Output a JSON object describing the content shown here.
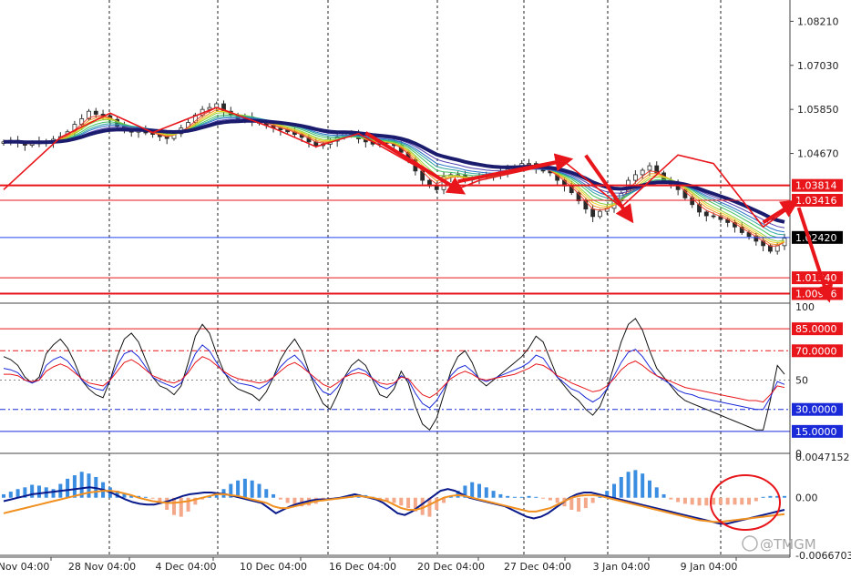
{
  "chart_data": [
    {
      "type": "candlestick",
      "role": "price",
      "ylim": [
        1.0066,
        1.0878
      ],
      "y_ticks": [
        "1.08210",
        "1.07030",
        "1.05850",
        "1.04670"
      ],
      "levels": [
        {
          "value": 1.03814,
          "label": "1.03814",
          "color": "#e8161b",
          "thick": true
        },
        {
          "value": 1.03416,
          "label": "1.03416",
          "color": "#e8161b",
          "thick": false
        },
        {
          "value": 1.0242,
          "label": "1.02420",
          "color": "#000000",
          "line_color": "#2244ee",
          "thick": false
        },
        {
          "value": 1.0134,
          "label": "1.01340",
          "color": "#e8161b",
          "thick": false
        },
        {
          "value": 1.00916,
          "label": "1.00916",
          "color": "#e8161b",
          "thick": true
        }
      ],
      "close": [
        1.0498,
        1.0502,
        1.0495,
        1.0489,
        1.0493,
        1.05,
        1.0497,
        1.0505,
        1.0512,
        1.0525,
        1.0545,
        1.056,
        1.058,
        1.0572,
        1.0568,
        1.0558,
        1.054,
        1.053,
        1.0524,
        1.053,
        1.0522,
        1.0518,
        1.0512,
        1.0507,
        1.052,
        1.0535,
        1.055,
        1.057,
        1.0585,
        1.059,
        1.06,
        1.058,
        1.057,
        1.056,
        1.0565,
        1.0555,
        1.0548,
        1.0542,
        1.0535,
        1.053,
        1.0525,
        1.0518,
        1.051,
        1.0498,
        1.0488,
        1.0492,
        1.05,
        1.051,
        1.052,
        1.0518,
        1.0506,
        1.0498,
        1.0492,
        1.0495,
        1.0497,
        1.0488,
        1.047,
        1.045,
        1.042,
        1.0395,
        1.038,
        1.037,
        1.0405,
        1.041,
        1.0408,
        1.0396,
        1.04,
        1.0406,
        1.0403,
        1.041,
        1.0418,
        1.0425,
        1.0432,
        1.044,
        1.044,
        1.0428,
        1.042,
        1.0415,
        1.0395,
        1.038,
        1.0362,
        1.034,
        1.0318,
        1.0298,
        1.0312,
        1.032,
        1.034,
        1.036,
        1.0395,
        1.041,
        1.0422,
        1.0434,
        1.0415,
        1.0395,
        1.0385,
        1.037,
        1.0348,
        1.033,
        1.031,
        1.03,
        1.0298,
        1.029,
        1.0282,
        1.027,
        1.0255,
        1.0245,
        1.0232,
        1.022,
        1.0205,
        1.022,
        1.024
      ],
      "ema_band_colors": [
        "#e84030",
        "#f09020",
        "#e8d020",
        "#90d040",
        "#40c060",
        "#30a8a0",
        "#2a70c8",
        "#5040b0"
      ],
      "slow_ma_color": "#1c1c6e",
      "zigzag": [
        [
          0,
          1.037
        ],
        [
          8,
          1.051
        ],
        [
          15,
          1.0575
        ],
        [
          21,
          1.0523
        ],
        [
          30,
          1.059
        ],
        [
          38,
          1.0535
        ],
        [
          44,
          1.0485
        ],
        [
          50,
          1.052
        ],
        [
          57,
          1.0445
        ],
        [
          64,
          1.0372
        ],
        [
          67,
          1.0395
        ],
        [
          79,
          1.0445
        ],
        [
          87,
          1.0323
        ],
        [
          95,
          1.0463
        ],
        [
          100,
          1.044
        ],
        [
          107,
          1.027
        ],
        [
          111,
          1.0325
        ]
      ],
      "arrows": [
        [
          51,
          1.0522,
          64,
          1.037
        ],
        [
          64,
          1.0392,
          79,
          1.0448
        ],
        [
          82,
          1.0462,
          88,
          1.03
        ],
        [
          97,
          1.0455
        ],
        [
          107,
          1.0282,
          111,
          1.033
        ],
        [
          112,
          1.0322,
          116,
          1.009
        ]
      ]
    },
    {
      "type": "line",
      "role": "oscillator",
      "ylim": [
        0,
        100
      ],
      "y_ticks": [
        "100",
        "50",
        "0"
      ],
      "levels": [
        {
          "value": 85,
          "label": "85.0000",
          "color": "#e8161b",
          "style": "solid"
        },
        {
          "value": 70,
          "label": "70.0000",
          "color": "#e8161b",
          "style": "dashdot"
        },
        {
          "value": 30,
          "label": "30.0000",
          "color": "#1a2ad8",
          "style": "dashdot"
        },
        {
          "value": 15,
          "label": "15.0000",
          "color": "#1a2ad8",
          "style": "solid"
        }
      ],
      "series": [
        {
          "color": "#111111",
          "values": [
            66,
            64,
            60,
            52,
            48,
            52,
            68,
            74,
            78,
            72,
            62,
            50,
            44,
            40,
            38,
            50,
            66,
            78,
            82,
            76,
            64,
            52,
            46,
            44,
            40,
            46,
            62,
            80,
            88,
            82,
            68,
            56,
            48,
            44,
            42,
            40,
            36,
            42,
            52,
            64,
            72,
            78,
            70,
            56,
            44,
            34,
            30,
            40,
            52,
            60,
            64,
            60,
            50,
            40,
            38,
            44,
            56,
            48,
            32,
            20,
            16,
            24,
            40,
            56,
            66,
            70,
            62,
            50,
            46,
            50,
            54,
            58,
            62,
            66,
            72,
            80,
            76,
            64,
            52,
            46,
            40,
            36,
            30,
            26,
            32,
            44,
            60,
            76,
            88,
            92,
            84,
            70,
            58,
            52,
            46,
            40,
            36,
            34,
            32,
            30,
            28,
            26,
            24,
            22,
            20,
            18,
            16,
            16,
            36,
            60,
            54
          ]
        },
        {
          "color": "#1a28d8",
          "values": [
            58,
            57,
            55,
            50,
            48,
            50,
            60,
            64,
            66,
            63,
            57,
            50,
            46,
            44,
            43,
            50,
            60,
            68,
            70,
            66,
            59,
            52,
            49,
            47,
            45,
            48,
            57,
            68,
            74,
            70,
            62,
            55,
            51,
            48,
            47,
            46,
            44,
            47,
            52,
            59,
            64,
            67,
            62,
            55,
            48,
            42,
            40,
            45,
            52,
            56,
            58,
            56,
            51,
            46,
            44,
            47,
            53,
            50,
            41,
            34,
            31,
            36,
            44,
            53,
            58,
            60,
            56,
            51,
            49,
            51,
            53,
            55,
            57,
            59,
            62,
            67,
            65,
            58,
            52,
            48,
            44,
            42,
            38,
            35,
            38,
            44,
            53,
            62,
            69,
            71,
            66,
            59,
            53,
            50,
            47,
            43,
            41,
            40,
            38,
            37,
            36,
            35,
            34,
            33,
            32,
            31,
            30,
            30,
            38,
            49,
            47
          ]
        },
        {
          "color": "#e8161b",
          "values": [
            54,
            54,
            53,
            50,
            49,
            50,
            56,
            59,
            61,
            59,
            55,
            51,
            48,
            47,
            46,
            50,
            56,
            62,
            64,
            61,
            57,
            53,
            51,
            49,
            48,
            50,
            55,
            62,
            66,
            64,
            60,
            56,
            53,
            51,
            50,
            49,
            48,
            49,
            52,
            56,
            60,
            62,
            59,
            55,
            51,
            47,
            45,
            48,
            52,
            54,
            55,
            54,
            51,
            48,
            47,
            48,
            52,
            51,
            45,
            40,
            38,
            41,
            46,
            51,
            54,
            56,
            54,
            51,
            50,
            51,
            52,
            53,
            54,
            56,
            58,
            61,
            60,
            57,
            53,
            51,
            48,
            46,
            44,
            42,
            43,
            46,
            51,
            57,
            61,
            63,
            60,
            56,
            53,
            51,
            49,
            47,
            45,
            44,
            43,
            42,
            41,
            40,
            39,
            38,
            37,
            36,
            36,
            35,
            40,
            46,
            45
          ]
        }
      ]
    },
    {
      "type": "bar",
      "role": "histogram",
      "ylim": [
        -0.0066703,
        0.0047152
      ],
      "y_ticks": [
        "0.0047152",
        "0.00",
        "-0.0066703"
      ],
      "values": [
        0.0004,
        0.0007,
        0.001,
        0.0012,
        0.0015,
        0.0014,
        0.0012,
        0.001,
        0.0016,
        0.0022,
        0.0026,
        0.003,
        0.0028,
        0.0024,
        0.0018,
        0.0012,
        0.0008,
        0.0005,
        0.0003,
        0.0002,
        0.0001,
        -0.0001,
        -0.0006,
        -0.0014,
        -0.002,
        -0.0022,
        -0.0016,
        -0.0008,
        -0.0002,
        0.0002,
        0.0006,
        0.001,
        0.0016,
        0.002,
        0.0022,
        0.002,
        0.0016,
        0.001,
        0.0004,
        -0.0002,
        -0.0006,
        -0.0008,
        -0.001,
        -0.0009,
        -0.0007,
        -0.0004,
        -0.0002,
        -0.0001,
        0.0001,
        0.0003,
        0.0004,
        0.0003,
        0.0001,
        -0.0002,
        -0.0004,
        -0.0006,
        -0.0009,
        -0.0012,
        -0.0016,
        -0.002,
        -0.0022,
        -0.0014,
        -0.0006,
        0.0002,
        0.0008,
        0.0014,
        0.0018,
        0.0016,
        0.0012,
        0.0008,
        0.0004,
        0.0002,
        0.0001,
        0.0001,
        0.0002,
        0.0001,
        -0.0001,
        -0.0003,
        -0.0006,
        -0.001,
        -0.0014,
        -0.0016,
        -0.0012,
        -0.0006,
        0.0001,
        0.0008,
        0.0016,
        0.0024,
        0.003,
        0.0032,
        0.0028,
        0.002,
        0.0012,
        0.0004,
        -0.0002,
        -0.0005,
        -0.0007,
        -0.0008,
        -0.0009,
        -0.0009,
        -0.0008,
        -0.0008,
        -0.0008,
        -0.0008,
        -0.0008,
        -0.0008,
        -0.0004,
        0.0001,
        0.0002,
        0.0002,
        0.0002
      ],
      "series": [
        {
          "color": "#0a1a8a",
          "values": [
            -0.0004,
            -0.0002,
            0.0,
            0.0002,
            0.0004,
            0.0005,
            0.0006,
            0.0007,
            0.0008,
            0.0009,
            0.001,
            0.0011,
            0.0012,
            0.0011,
            0.0009,
            0.0006,
            0.0002,
            -0.0002,
            -0.0005,
            -0.0007,
            -0.0008,
            -0.0008,
            -0.0006,
            -0.0004,
            -0.0001,
            0.0002,
            0.0004,
            0.0005,
            0.0006,
            0.0006,
            0.0005,
            0.0004,
            0.0002,
            0.0,
            -0.0002,
            -0.0004,
            -0.0006,
            -0.0012,
            -0.0018,
            -0.0014,
            -0.001,
            -0.0007,
            -0.0005,
            -0.0003,
            -0.0002,
            -0.0002,
            -0.0001,
            0.0,
            0.0002,
            0.0004,
            0.0002,
            0.0,
            -0.0002,
            -0.0006,
            -0.0012,
            -0.0018,
            -0.002,
            -0.0016,
            -0.001,
            -0.0004,
            0.0002,
            0.0008,
            0.001,
            0.0008,
            0.0004,
            0.0,
            -0.0002,
            -0.0004,
            -0.0006,
            -0.0008,
            -0.001,
            -0.0014,
            -0.0018,
            -0.0022,
            -0.0024,
            -0.0022,
            -0.0018,
            -0.0012,
            -0.0006,
            0.0,
            0.0004,
            0.0006,
            0.0006,
            0.0004,
            0.0002,
            0.0,
            -0.0002,
            -0.0004,
            -0.0006,
            -0.0008,
            -0.001,
            -0.0012,
            -0.0014,
            -0.0016,
            -0.0018,
            -0.002,
            -0.0022,
            -0.0024,
            -0.0026,
            -0.0028,
            -0.003,
            -0.003,
            -0.0028,
            -0.0026,
            -0.0024,
            -0.0022,
            -0.002,
            -0.0018,
            -0.0016,
            -0.0014
          ]
        },
        {
          "color": "#f09020",
          "values": [
            -0.0018,
            -0.0016,
            -0.0014,
            -0.0012,
            -0.001,
            -0.0008,
            -0.0006,
            -0.0004,
            -0.0002,
            0.0,
            0.0002,
            0.0004,
            0.0006,
            0.0007,
            0.0008,
            0.0008,
            0.0007,
            0.0005,
            0.0003,
            0.0,
            -0.0002,
            -0.0004,
            -0.0005,
            -0.0006,
            -0.0006,
            -0.0005,
            -0.0004,
            -0.0002,
            0.0,
            0.0002,
            0.0004,
            0.0004,
            0.0003,
            0.0002,
            0.0,
            -0.0002,
            -0.0004,
            -0.0006,
            -0.001,
            -0.0012,
            -0.0012,
            -0.001,
            -0.0008,
            -0.0006,
            -0.0004,
            -0.0003,
            -0.0002,
            -0.0001,
            0.0,
            0.0001,
            0.0002,
            0.0001,
            0.0,
            -0.0002,
            -0.0004,
            -0.0008,
            -0.0012,
            -0.0014,
            -0.0014,
            -0.0012,
            -0.0008,
            -0.0004,
            0.0,
            0.0002,
            0.0003,
            0.0002,
            0.0,
            -0.0002,
            -0.0004,
            -0.0006,
            -0.0008,
            -0.001,
            -0.0012,
            -0.0014,
            -0.0016,
            -0.0016,
            -0.0014,
            -0.0012,
            -0.0008,
            -0.0004,
            0.0,
            0.0002,
            0.0003,
            0.0003,
            0.0002,
            0.0,
            -0.0002,
            -0.0004,
            -0.0006,
            -0.0008,
            -0.001,
            -0.0012,
            -0.0014,
            -0.0016,
            -0.0018,
            -0.002,
            -0.0022,
            -0.0024,
            -0.0026,
            -0.0027,
            -0.0028,
            -0.0028,
            -0.0027,
            -0.0026,
            -0.0025,
            -0.0024,
            -0.0023,
            -0.0022,
            -0.0021,
            -0.002,
            -0.0019
          ]
        }
      ],
      "pos_color": "#3a8de0",
      "neg_color": "#f4a88a"
    }
  ],
  "x_axis": {
    "labels": [
      "Nov 04:00",
      "28 Nov 04:00",
      "4 Dec 04:00",
      "10 Dec 04:00",
      "16 Dec 04:00",
      "20 Dec 04:00",
      "27 Dec 04:00",
      "3 Jan 04:00",
      "9 Jan 04:00"
    ]
  },
  "watermark": {
    "text": "@TMGM"
  }
}
